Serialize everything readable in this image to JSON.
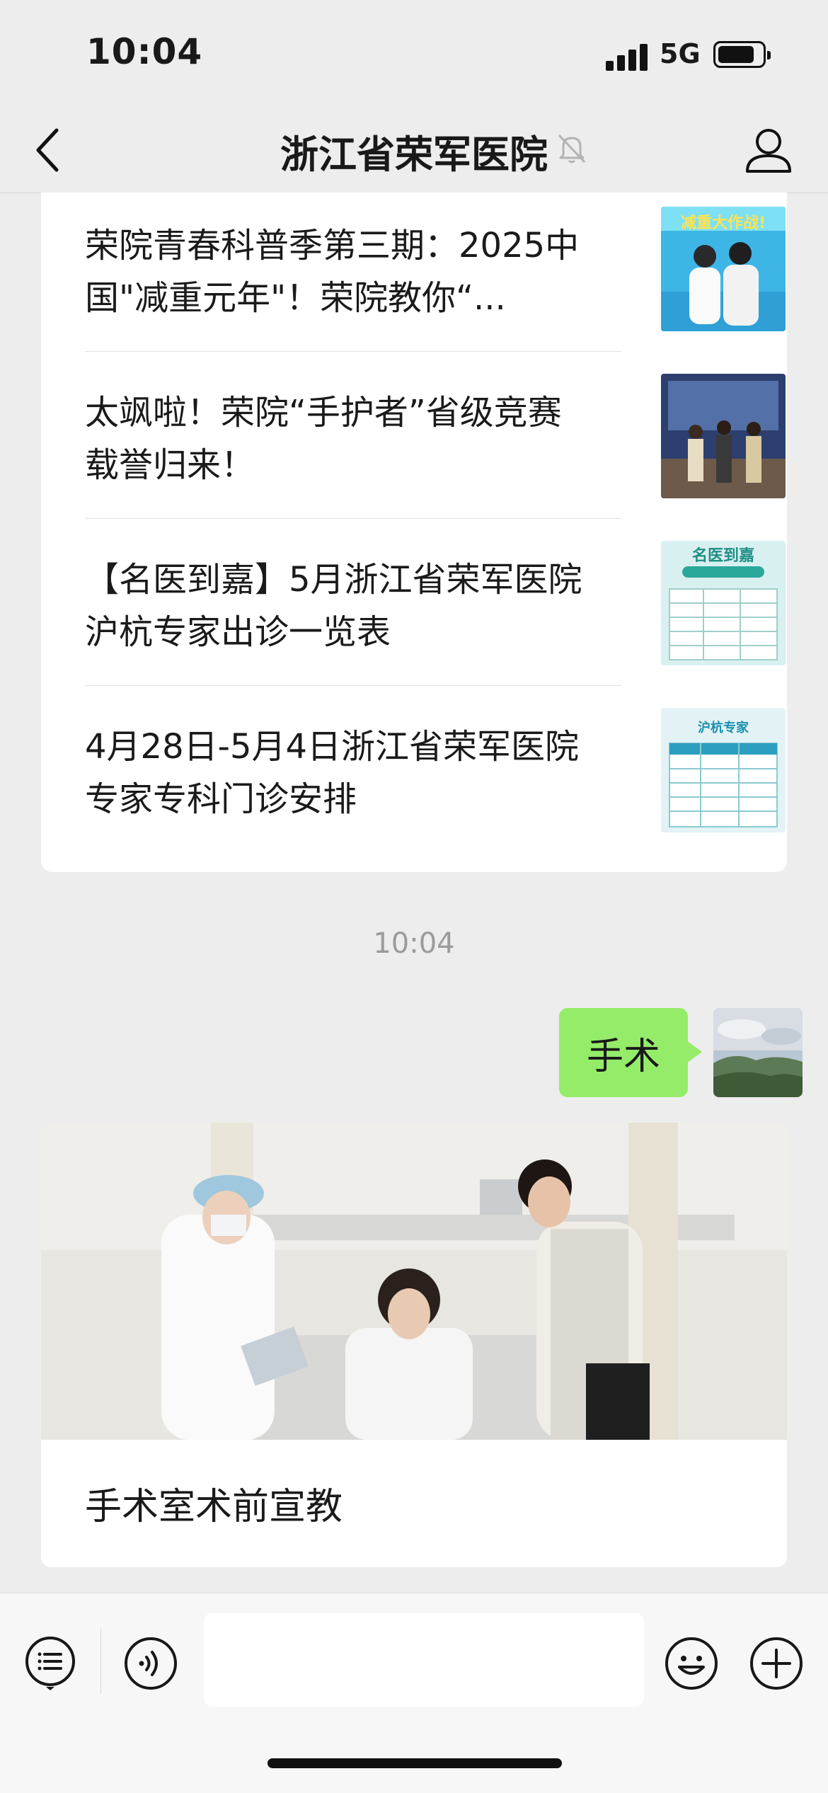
{
  "status_bar": {
    "time": "10:04",
    "network": "5G"
  },
  "header": {
    "title": "浙江省荣军医院"
  },
  "articles": [
    {
      "title": "荣院青春科普季第三期：2025中国\"减重元年\"！荣院教你“...",
      "thumb_text": "减重大作战!"
    },
    {
      "title": "太飒啦！荣院“手护者”省级竞赛载誉归来！",
      "thumb_text": ""
    },
    {
      "title": "【名医到嘉】5月浙江省荣军医院沪杭专家出诊一览表",
      "thumb_text": "名医到嘉"
    },
    {
      "title": "4月28日-5月4日浙江省荣军医院专家专科门诊安排",
      "thumb_text": "沪杭专家"
    }
  ],
  "chat": {
    "timestamp": "10:04",
    "user_message": "手术",
    "reply_card": {
      "title": "手术室术前宣教"
    }
  },
  "colors": {
    "bubble": "#95ec69",
    "background": "#ededed"
  }
}
